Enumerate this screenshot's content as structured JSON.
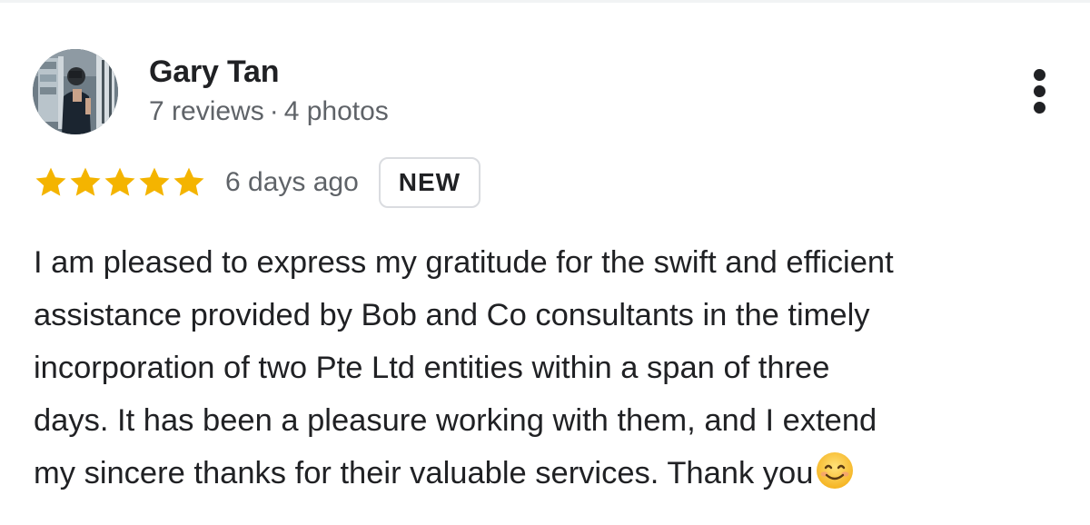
{
  "review": {
    "author": {
      "name": "Gary Tan",
      "reviews": "7 reviews",
      "separator": "·",
      "photos": "4 photos"
    },
    "more_icon": "vertical-ellipsis-icon",
    "rating": {
      "value": 5,
      "max": 5,
      "star_color": "#f4b400",
      "icon": "star-icon"
    },
    "date": "6 days ago",
    "badge": "NEW",
    "text_lines": [
      "I am pleased to express my gratitude for the swift and efficient",
      "assistance provided by Bob and Co consultants in the timely",
      "incorporation of two Pte Ltd entities within a span of three",
      "days. It has been a pleasure working with them, and I extend",
      "my sincere thanks for their valuable services. Thank you"
    ],
    "emoji_icon": "smiling-face-emoji-icon"
  }
}
